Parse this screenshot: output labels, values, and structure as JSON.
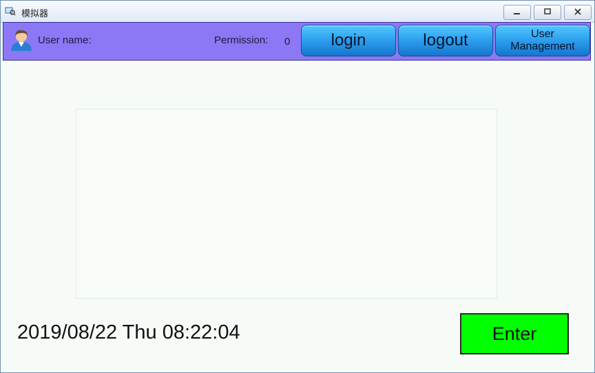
{
  "window": {
    "title": "模拟器",
    "icons": {
      "app": "app-icon",
      "minimize": "minimize-icon",
      "restore": "restore-icon",
      "close": "close-icon"
    }
  },
  "toolbar": {
    "avatar_icon": "user-avatar-icon",
    "username_label": "User name:",
    "permission_label": "Permission:",
    "permission_value": "0",
    "login_label": "login",
    "logout_label": "logout",
    "user_management_label_line1": "User",
    "user_management_label_line2": "Management",
    "colors": {
      "bar": "#8c78f5",
      "button": "#2ea2ef"
    }
  },
  "footer": {
    "datetime": "2019/08/22 Thu 08:22:04",
    "enter_label": "Enter",
    "enter_color": "#00ff00"
  }
}
